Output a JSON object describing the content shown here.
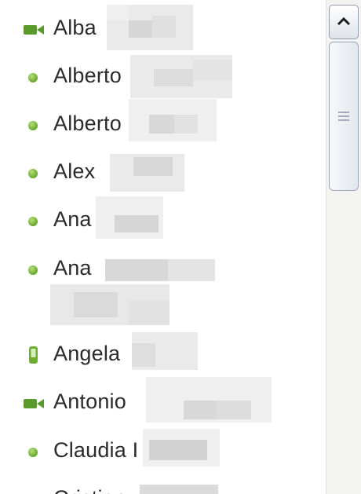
{
  "contacts": [
    {
      "name": "Alba",
      "status": "video-chat",
      "color": "#5a9a2c"
    },
    {
      "name": "Alberto",
      "status": "online"
    },
    {
      "name": "Alberto",
      "status": "online"
    },
    {
      "name": "Alex",
      "status": "online"
    },
    {
      "name": "Ana",
      "status": "online"
    },
    {
      "name": "Ana",
      "status": "online"
    },
    {
      "name": "Angela",
      "status": "mobile"
    },
    {
      "name": "Antonio",
      "status": "video-chat"
    },
    {
      "name": "Claudia I",
      "status": "online"
    },
    {
      "name": "Cristian",
      "status": "online"
    }
  ],
  "colors": {
    "online": "#76b33a",
    "text": "#2b2b2b",
    "scrollbar_border": "#8f9bb0"
  },
  "icons": {
    "online": "online-status-dot-icon",
    "video": "video-camera-icon",
    "mobile": "mobile-phone-icon",
    "scroll_up": "chevron-up-icon",
    "grip": "scroll-grip-icon"
  }
}
